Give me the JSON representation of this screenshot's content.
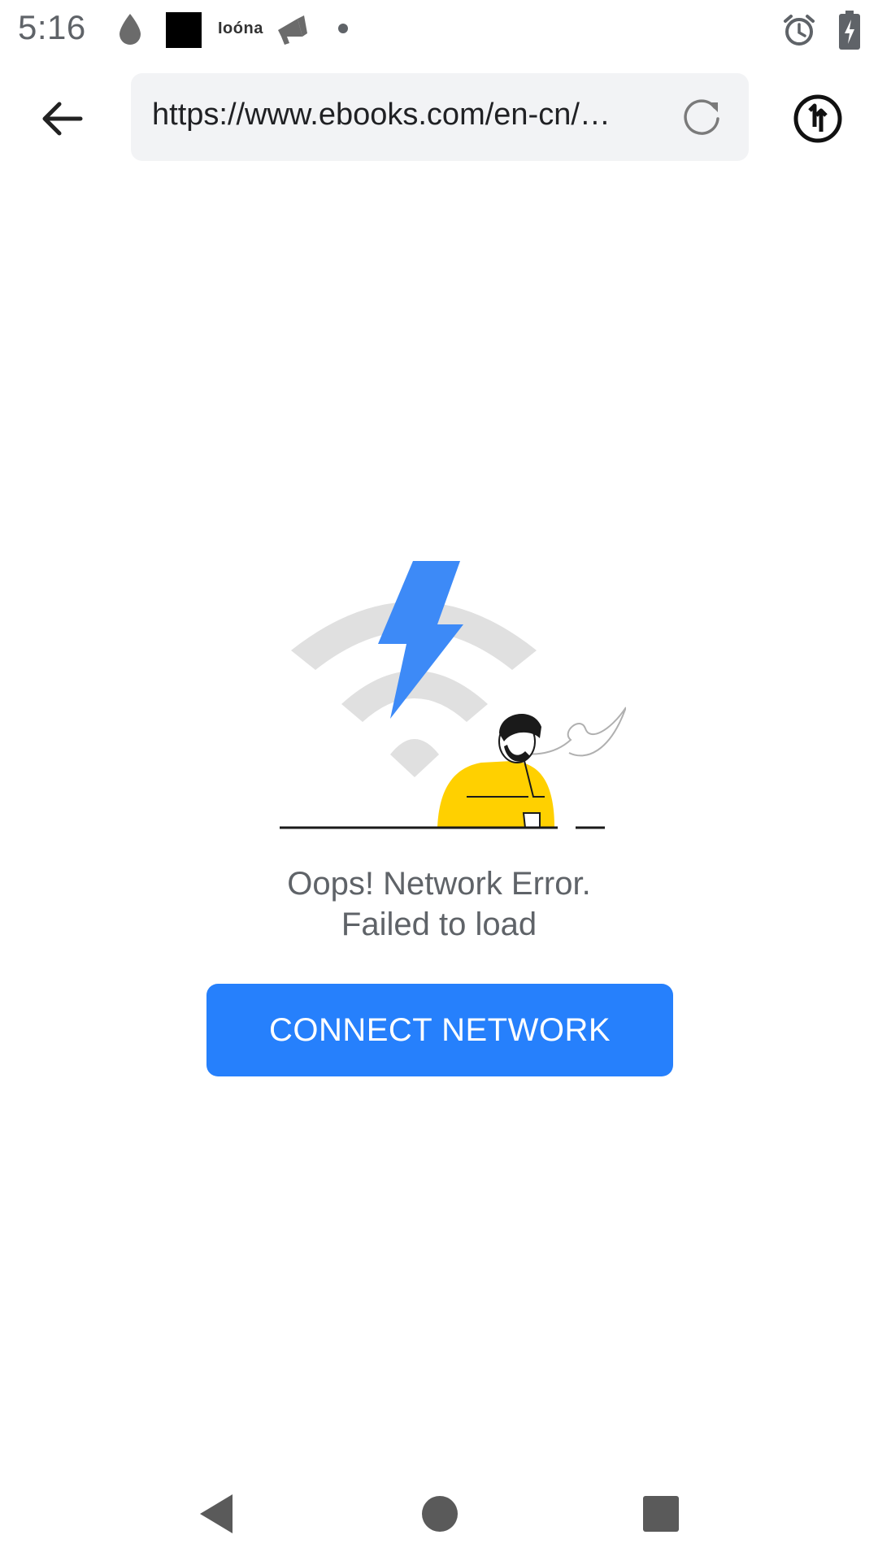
{
  "status_bar": {
    "time": "5:16",
    "app_label": "Ioóna",
    "icons": [
      "water-drop-icon",
      "black-square-icon",
      "megaphone-icon",
      "dot-icon",
      "alarm-icon",
      "battery-charging-icon"
    ]
  },
  "toolbar": {
    "back_icon": "arrow-left-icon",
    "url": "https://www.ebooks.com/en-cn/…",
    "reload_icon": "reload-icon",
    "extension_icon": "circle-extension-icon"
  },
  "error": {
    "line1": "Oops! Network Error.",
    "line2": "Failed to load",
    "button_label": "CONNECT NETWORK"
  },
  "nav": {
    "back_icon": "triangle-back-icon",
    "home_icon": "circle-home-icon",
    "recents_icon": "square-recents-icon"
  },
  "colors": {
    "accent": "#2680fc",
    "bolt": "#3d8af7",
    "shirt": "#ffd000",
    "wifi_gray": "#e0e0e0",
    "text_gray": "#5f6368"
  }
}
